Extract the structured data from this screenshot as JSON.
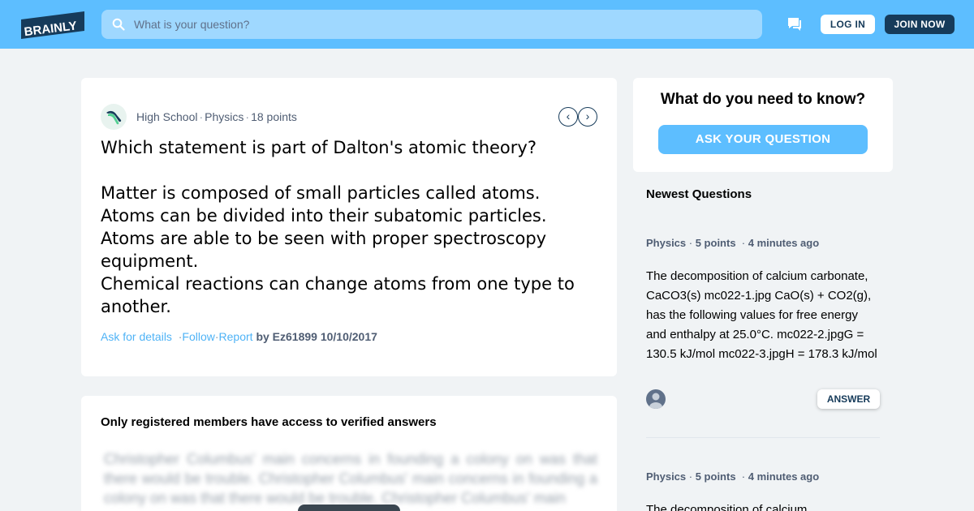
{
  "header": {
    "logo_text": "BRAINLY",
    "search_placeholder": "What is your question?",
    "login_label": "LOG IN",
    "join_label": "JOIN NOW",
    "brand_color": "#5dbeff",
    "dark_color": "#163b5a"
  },
  "question": {
    "level": "High School",
    "subject": "Physics",
    "points": "18 points",
    "title": "Which statement is part of Dalton's atomic theory?",
    "lines": [
      "Matter is composed of small particles called atoms.",
      "Atoms can be divided into their subatomic particles.",
      "Atoms are able to be seen with proper spectroscopy",
      "equipment.",
      "Chemical reactions can change atoms from one type to",
      "another."
    ],
    "ask_details": "Ask for details",
    "follow": "Follow",
    "report": "Report",
    "by_author": "by Ez61899 10/10/2017",
    "prev_icon": "‹",
    "next_icon": "›"
  },
  "answer": {
    "notice": "Only registered members have access to verified answers",
    "blurred_text": "Christopher Columbus' main concerns in founding a colony on was that there would be trouble. Christopher Columbus' main concerns in founding a colony on was that there would be trouble. Christopher Columbus' main"
  },
  "sidebar": {
    "ask_title": "What do you need to know?",
    "ask_button": "ASK YOUR QUESTION",
    "newest_title": "Newest Questions",
    "items": [
      {
        "subject": "Physics",
        "points": "5 points",
        "time": "4 minutes ago",
        "text": "The decomposition of calcium carbonate, CaCO3(s) mc022-1.jpg CaO(s) + CO2(g), has the following values for free energy and enthalpy at 25.0°C. mc022-2.jpgG = 130.5 kJ/mol mc022-3.jpgH = 178.3 kJ/mol",
        "answer_label": "ANSWER"
      },
      {
        "subject": "Physics",
        "points": "5 points",
        "time": "4 minutes ago",
        "text": "The decomposition of calcium"
      }
    ]
  }
}
